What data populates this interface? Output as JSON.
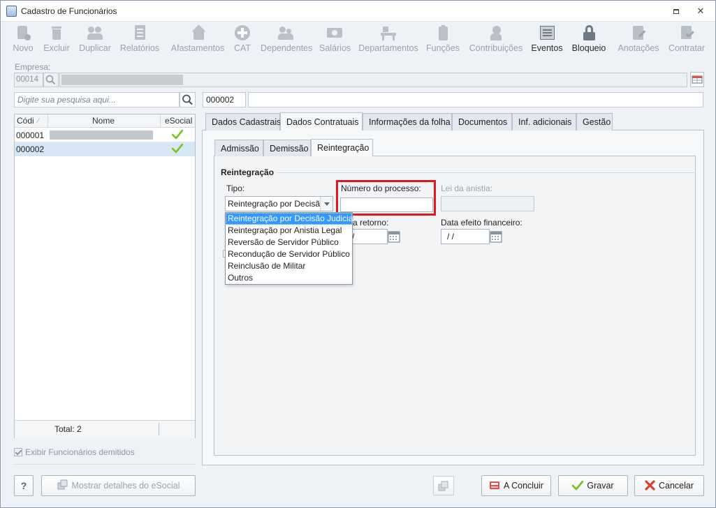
{
  "window": {
    "title": "Cadastro de Funcionários"
  },
  "toolbar": {
    "items": [
      {
        "label": "Novo",
        "icon": "new-person-icon",
        "enabled": false
      },
      {
        "label": "Excluir",
        "icon": "trash-icon",
        "enabled": false
      },
      {
        "label": "Duplicar",
        "icon": "duplicate-people-icon",
        "enabled": false
      },
      {
        "label": "Relatórios",
        "icon": "report-icon",
        "enabled": false
      },
      {
        "label": "Afastamentos",
        "icon": "house-arrow-icon",
        "enabled": false
      },
      {
        "label": "CAT",
        "icon": "medical-cross-icon",
        "enabled": false
      },
      {
        "label": "Dependentes",
        "icon": "dependents-icon",
        "enabled": false
      },
      {
        "label": "Salários",
        "icon": "money-icon",
        "enabled": false
      },
      {
        "label": "Departamentos",
        "icon": "desk-icon",
        "enabled": false
      },
      {
        "label": "Funções",
        "icon": "badge-icon",
        "enabled": false
      },
      {
        "label": "Contribuições",
        "icon": "contributions-icon",
        "enabled": false
      },
      {
        "label": "Eventos",
        "icon": "events-list-icon",
        "enabled": true
      },
      {
        "label": "Bloqueio",
        "icon": "lock-icon",
        "enabled": true
      },
      {
        "label": "Anotações",
        "icon": "notes-icon",
        "enabled": false
      },
      {
        "label": "Contratar",
        "icon": "contract-icon",
        "enabled": false
      }
    ]
  },
  "empresa": {
    "label": "Empresa:",
    "code": "00014"
  },
  "search": {
    "placeholder": "Digite sua pesquisa aqui...",
    "code_value": "000002"
  },
  "grid": {
    "headers": [
      "Códi",
      "Nome",
      "eSocial"
    ],
    "rows": [
      {
        "code": "000001",
        "selected": false
      },
      {
        "code": "000002",
        "selected": true
      }
    ],
    "total": "Total: 2"
  },
  "show_dismissed": {
    "label": "Exibir Funcionários demitidos",
    "checked": true
  },
  "main_tabs": [
    "Dados Cadastrais",
    "Dados Contratuais",
    "Informações da folha",
    "Documentos",
    "Inf. adicionais",
    "Gestão"
  ],
  "sub_tabs": [
    "Admissão",
    "Demissão",
    "Reintegração"
  ],
  "reintegracao": {
    "section_title": "Reintegração",
    "tipo_label": "Tipo:",
    "tipo_value": "Reintegração por Decisão Judicial",
    "numero_processo_label": "Número do processo:",
    "lei_anistia_label": "Lei da anistia:",
    "data_retorno_label": "a retorno:",
    "data_retorno_value": "/",
    "data_efeito_label": "Data efeito financeiro:",
    "data_efeito_value": "/  /",
    "tipo_options": [
      "Reintegração por Decisão Judicial",
      "Reintegração por Anistia Legal",
      "Reversão de Servidor Público",
      "Recondução de Servidor Público",
      "Reinclusão de Militar",
      "Outros"
    ]
  },
  "buttons": {
    "help": "?",
    "show_esocial": "Mostrar detalhes do eSocial",
    "concluir": "A Concluir",
    "gravar": "Gravar",
    "cancelar": "Cancelar"
  },
  "colors": {
    "highlight": "#e01a22",
    "selection": "#3399ff",
    "check": "#7cc21e",
    "cancel": "#d9412b"
  }
}
